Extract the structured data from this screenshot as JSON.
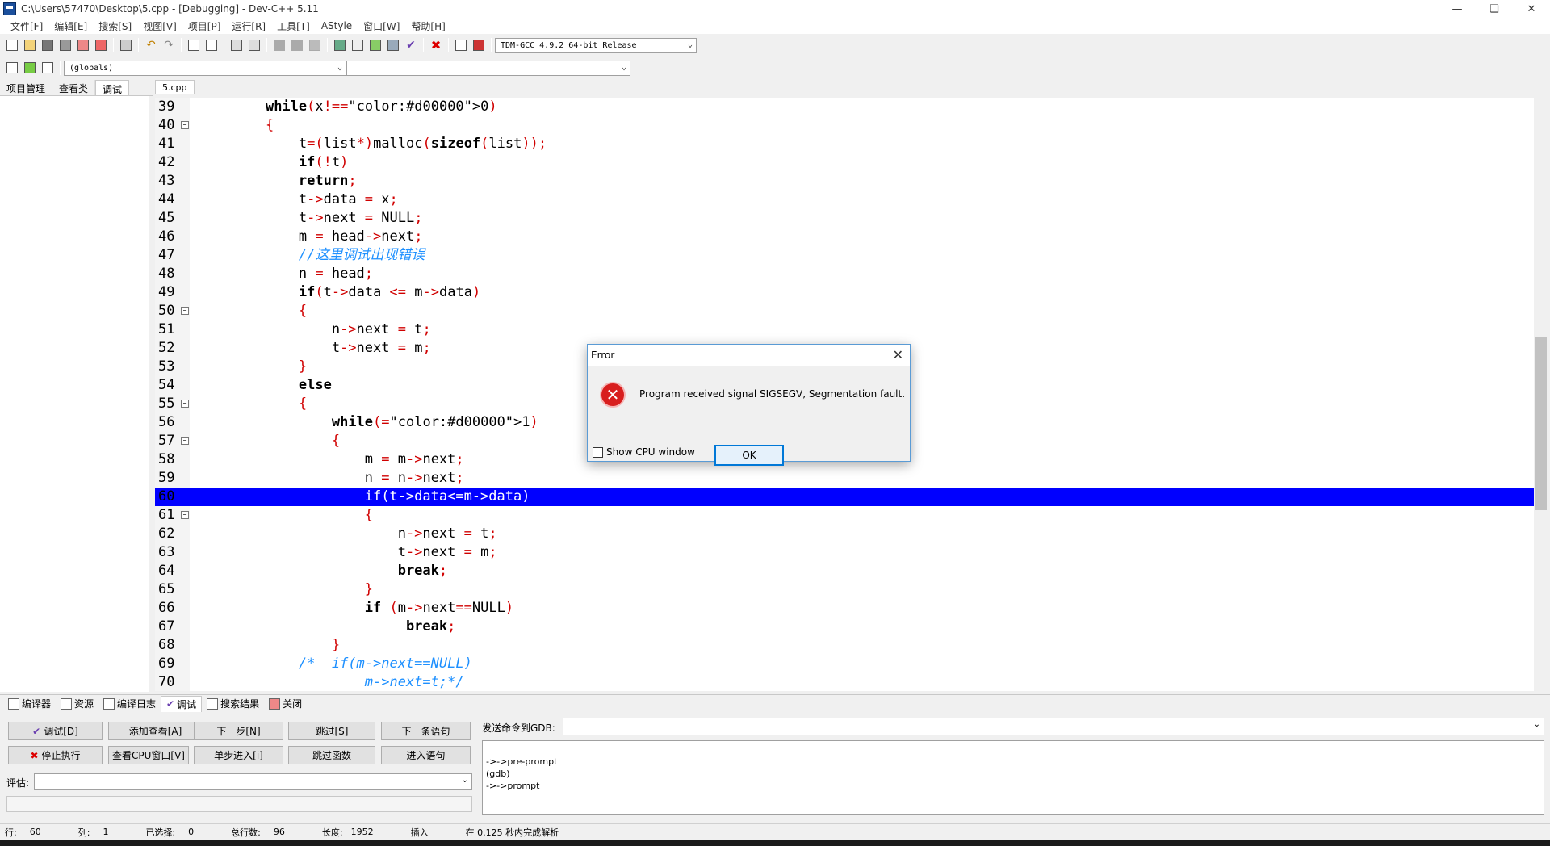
{
  "window": {
    "title": "C:\\Users\\57470\\Desktop\\5.cpp - [Debugging] - Dev-C++ 5.11",
    "minimize_icon": "minimize-icon",
    "restore_icon": "restore-icon",
    "close_icon": "close-icon"
  },
  "menu": [
    "文件[F]",
    "编辑[E]",
    "搜索[S]",
    "视图[V]",
    "项目[P]",
    "运行[R]",
    "工具[T]",
    "AStyle",
    "窗口[W]",
    "帮助[H]"
  ],
  "toolbar": {
    "compiler_select": "TDM-GCC 4.9.2 64-bit Release",
    "scope_select": "(globals)",
    "member_select": ""
  },
  "left_panel": {
    "tabs": [
      "项目管理",
      "查看类",
      "调试"
    ],
    "active_tab": "调试"
  },
  "editor": {
    "file_tab": "5.cpp",
    "highlight_line": 60,
    "lines": [
      {
        "n": "39",
        "code": "    while(x!=0)"
      },
      {
        "n": "40",
        "code": "    {"
      },
      {
        "n": "41",
        "code": "        t=(list*)malloc(sizeof(list));"
      },
      {
        "n": "42",
        "code": "        if(!t)"
      },
      {
        "n": "43",
        "code": "        return;"
      },
      {
        "n": "44",
        "code": "        t->data = x;"
      },
      {
        "n": "45",
        "code": "        t->next = NULL;"
      },
      {
        "n": "46",
        "code": "        m = head->next;"
      },
      {
        "n": "47",
        "code": "        //这里调试出现错误"
      },
      {
        "n": "48",
        "code": "        n = head;"
      },
      {
        "n": "49",
        "code": "        if(t->data <= m->data)"
      },
      {
        "n": "50",
        "code": "        {"
      },
      {
        "n": "51",
        "code": "            n->next = t;"
      },
      {
        "n": "52",
        "code": "            t->next = m;"
      },
      {
        "n": "53",
        "code": "        }"
      },
      {
        "n": "54",
        "code": "        else"
      },
      {
        "n": "55",
        "code": "        {"
      },
      {
        "n": "56",
        "code": "            while(1)"
      },
      {
        "n": "57",
        "code": "            {"
      },
      {
        "n": "58",
        "code": "                m = m->next;"
      },
      {
        "n": "59",
        "code": "                n = n->next;"
      },
      {
        "n": "60",
        "code": "                if(t->data<=m->data)"
      },
      {
        "n": "61",
        "code": "                {"
      },
      {
        "n": "62",
        "code": "                    n->next = t;"
      },
      {
        "n": "63",
        "code": "                    t->next = m;"
      },
      {
        "n": "64",
        "code": "                    break;"
      },
      {
        "n": "65",
        "code": "                }"
      },
      {
        "n": "66",
        "code": "                if (m->next==NULL)"
      },
      {
        "n": "67",
        "code": "                     break;"
      },
      {
        "n": "68",
        "code": "            }"
      },
      {
        "n": "69",
        "code": "        /*  if(m->next==NULL)"
      },
      {
        "n": "70",
        "code": "                m->next=t;*/"
      }
    ]
  },
  "bottom": {
    "tabs": [
      "编译器",
      "资源",
      "编译日志",
      "调试",
      "搜索结果",
      "关闭"
    ],
    "active_tab": "调试",
    "buttons": {
      "debug": "调试[D]",
      "add_watch": "添加查看[A]",
      "next_step": "下一步[N]",
      "skip": "跳过[S]",
      "next_stmt": "下一条语句",
      "stop": "停止执行",
      "cpu_window": "查看CPU窗口[V]",
      "step_into": "单步进入[i]",
      "skip_func": "跳过函数",
      "into_stmt": "进入语句"
    },
    "eval_label": "评估:",
    "gdb_label": "发送命令到GDB:",
    "gdb_output": [
      "->->pre-prompt",
      "(gdb)",
      "->->prompt"
    ]
  },
  "status": {
    "row_label": "行:",
    "row": "60",
    "col_label": "列:",
    "col": "1",
    "sel_label": "已选择:",
    "sel": "0",
    "total_label": "总行数:",
    "total": "96",
    "len_label": "长度:",
    "len": "1952",
    "mode": "插入",
    "parse": "在 0.125 秒内完成解析"
  },
  "dialog": {
    "title": "Error",
    "message": "Program received signal SIGSEGV, Segmentation fault.",
    "ok": "OK",
    "checkbox": "Show CPU window"
  }
}
